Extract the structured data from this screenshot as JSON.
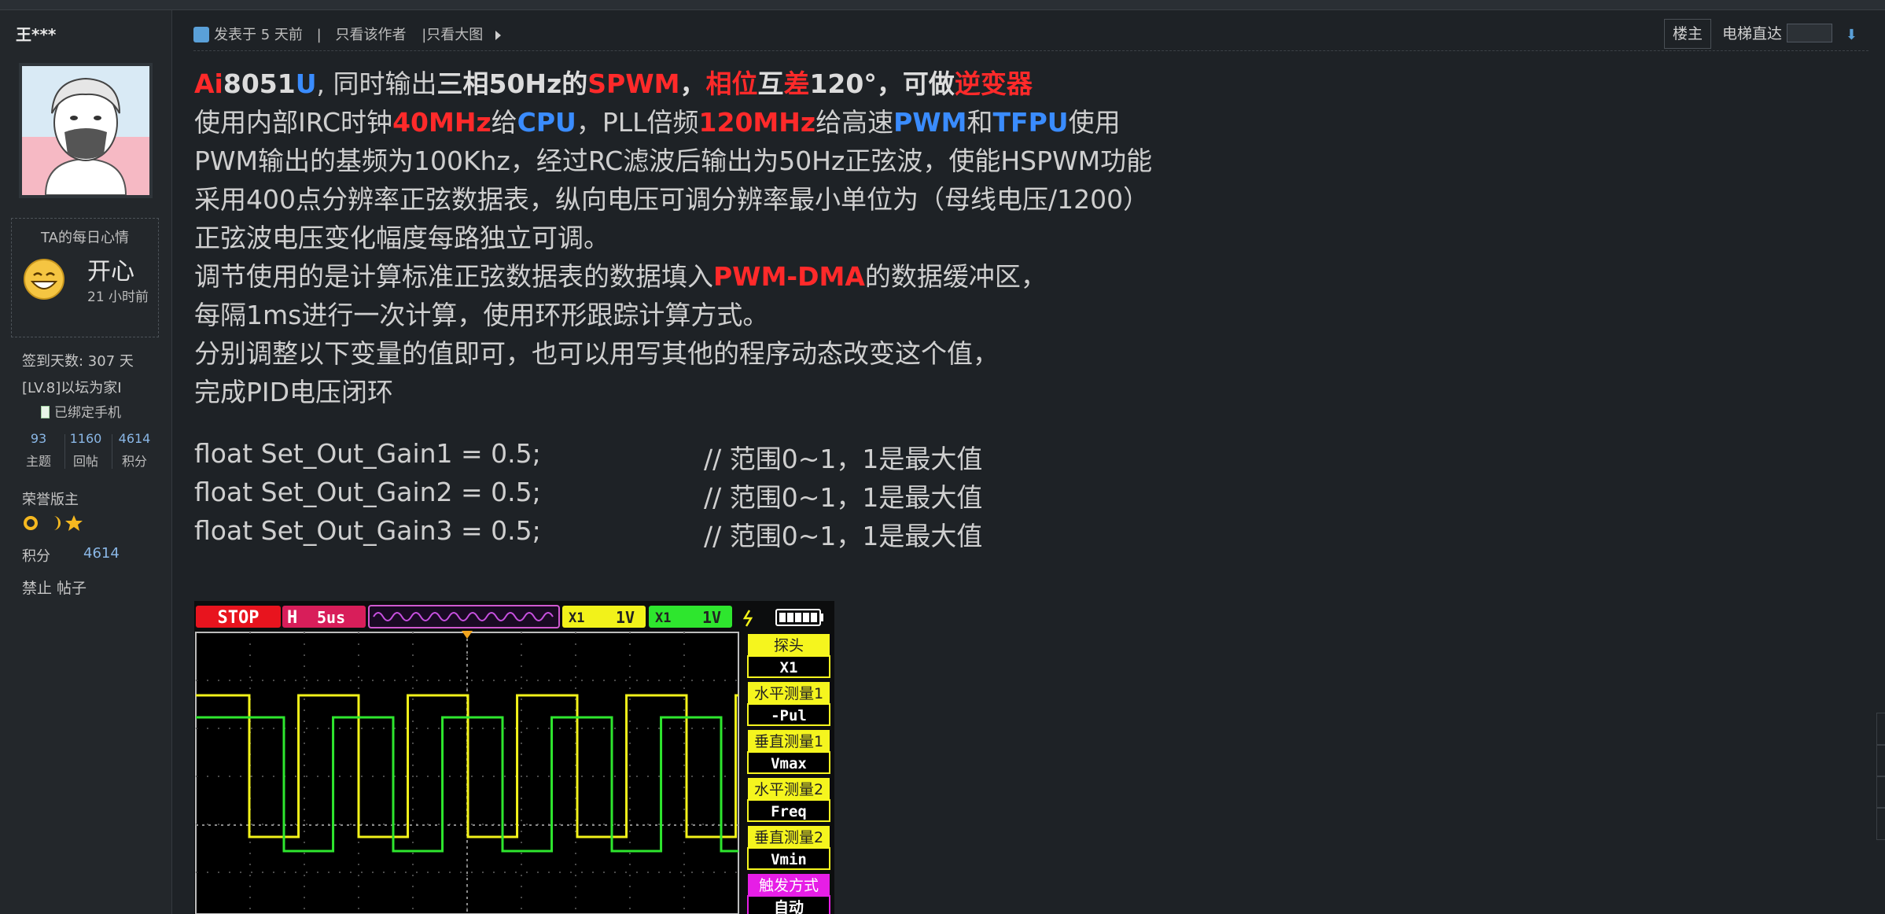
{
  "sidebar": {
    "username": "王***",
    "mood_title": "TA的每日心情",
    "mood_word": "开心",
    "mood_time": "21 小时前",
    "checkin": "签到天数: 307 天",
    "level": "[LV.8]以坛为家I",
    "phone": "已绑定手机",
    "stats": [
      {
        "num": "93",
        "label": "主题"
      },
      {
        "num": "1160",
        "label": "回帖"
      },
      {
        "num": "4614",
        "label": "积分"
      }
    ],
    "honor": "荣誉版主",
    "score_label": "积分",
    "score_value": "4614",
    "actions": "禁止 帖子"
  },
  "post_header": {
    "posted": "发表于 5 天前",
    "sep": "|",
    "only_author": "只看该作者",
    "only_big": "|只看大图",
    "floor": "楼主",
    "elevator": "电梯直达"
  },
  "post": {
    "l1": {
      "a": "Ai",
      "b": "8051",
      "c": "U",
      "d": ", 同时输出",
      "e": "三相50Hz的",
      "f": "SPWM",
      "g": "，",
      "h": "相位",
      "i": "互",
      "j": "差",
      "k": "120°，可做",
      "l": "逆变器"
    },
    "l2": {
      "a": "使用内部IRC时钟",
      "b": "40MHz",
      "c": "给",
      "d": "CPU",
      "e": "，PLL倍频",
      "f": "120MHz",
      "g": "给高速",
      "h": "PWM",
      "i": "和",
      "j": "TFPU",
      "k": "使用"
    },
    "l3": "PWM输出的基频为100Khz，经过RC滤波后输出为50Hz正弦波，使能HSPWM功能",
    "l4": "采用400点分辨率正弦数据表，纵向电压可调分辨率最小单位为（母线电压/1200）",
    "l5": "正弦波电压变化幅度每路独立可调。",
    "l6": {
      "a": "调节使用的是计算标准正弦数据表的数据填入",
      "b": "PWM-DMA",
      "c": "的数据缓冲区，"
    },
    "l7": "每隔1ms进行一次计算，使用环形跟踪计算方式。",
    "l8": "分别调整以下变量的值即可，也可以用写其他的程序动态改变这个值，",
    "l9": "完成PID电压闭环",
    "code": [
      {
        "stmt": "float Set_Out_Gain1 = 0.5;",
        "comment": "// 范围0~1，1是最大值"
      },
      {
        "stmt": "float Set_Out_Gain2 = 0.5;",
        "comment": "// 范围0~1，1是最大值"
      },
      {
        "stmt": "float Set_Out_Gain3 = 0.5;",
        "comment": "// 范围0~1，1是最大值"
      }
    ]
  },
  "scope": {
    "stop": "STOP",
    "h": "H",
    "timebase": "5us",
    "ch1_scale": "1V",
    "ch2_scale": "1V",
    "ch1_tag": "X1",
    "ch2_tag": "X1",
    "menu": [
      {
        "title": "探头",
        "value": "X1"
      },
      {
        "title": "水平测量1",
        "value": "-Pul"
      },
      {
        "title": "垂直测量1",
        "value": "Vmax"
      },
      {
        "title": "水平测量2",
        "value": "Freq"
      },
      {
        "title": "垂直测量2",
        "value": "Vmin"
      },
      {
        "title": "触发方式",
        "value": "自动"
      }
    ],
    "colors": {
      "ch1": "#f2f21a",
      "ch2": "#2ee62e",
      "stop": "#e8141e",
      "menu": "#f5f51e",
      "trigger_menu": "#e61ee6"
    }
  }
}
